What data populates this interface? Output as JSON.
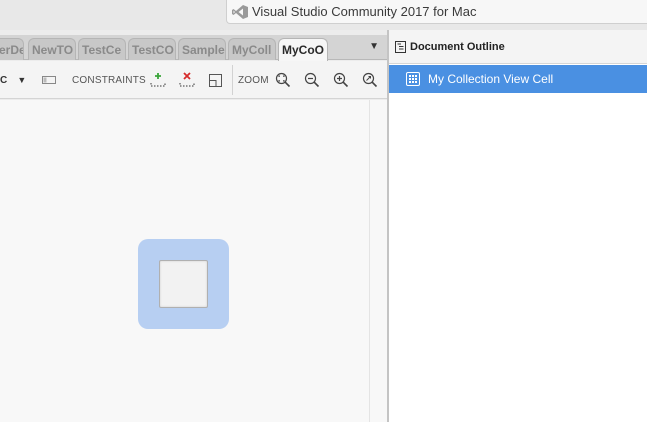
{
  "window": {
    "title": "Visual Studio Community 2017 for Mac",
    "logo_icon": "visual-studio-logo-icon"
  },
  "tabs": [
    {
      "label": "erDe",
      "active": false
    },
    {
      "label": "NewTO",
      "active": false
    },
    {
      "label": "TestCe",
      "active": false
    },
    {
      "label": "TestCO",
      "active": false
    },
    {
      "label": "Sample",
      "active": false
    },
    {
      "label": "MyColl",
      "active": false
    },
    {
      "label": "MyCoO",
      "active": true
    }
  ],
  "tab_overflow_icon": "chevron-down-icon",
  "toolbar": {
    "partial_label": "C",
    "dropdown_icon": "triangle-down-icon",
    "constraints_label": "CONSTRAINTS",
    "zoom_label": "ZOOM",
    "icons": [
      "frame-icon",
      "add-constraint-icon",
      "remove-constraint-icon",
      "update-frame-icon",
      "zoom-fit-icon",
      "zoom-out-icon",
      "zoom-in-icon",
      "zoom-actual-icon"
    ]
  },
  "outline": {
    "title": "Document Outline",
    "items": [
      {
        "label": "My Collection View Cell",
        "icon": "collection-view-cell-icon",
        "selected": true
      }
    ]
  },
  "colors": {
    "selection": "#4a90e2",
    "cell_highlight": "#b7cff2",
    "add_green": "#3aa53a",
    "remove_red": "#d62b2b"
  }
}
